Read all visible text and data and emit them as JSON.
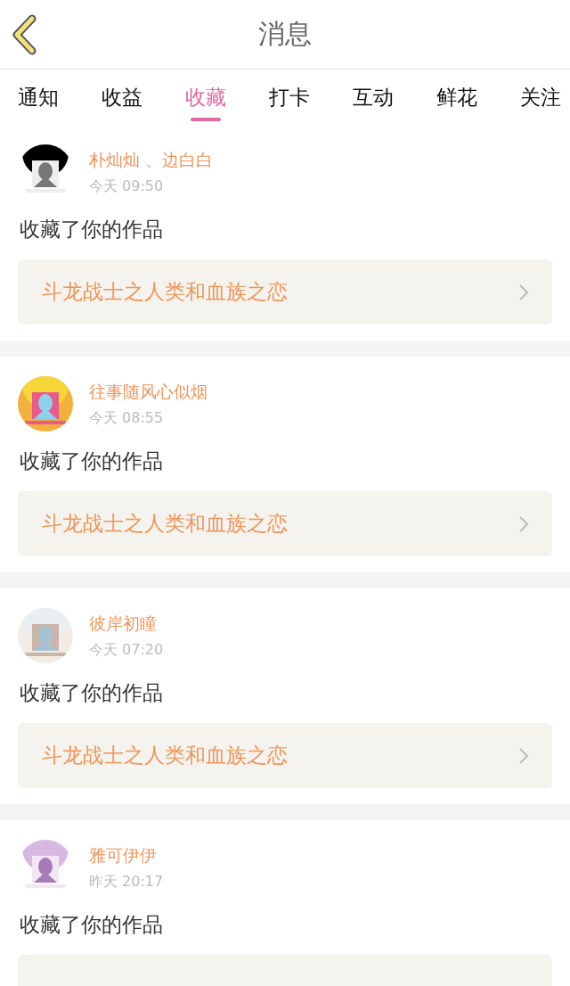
{
  "header": {
    "title": "消息"
  },
  "tabs": [
    {
      "label": "通知",
      "selected": false
    },
    {
      "label": "收益",
      "selected": false
    },
    {
      "label": "收藏",
      "selected": true
    },
    {
      "label": "打卡",
      "selected": false
    },
    {
      "label": "互动",
      "selected": false
    },
    {
      "label": "鲜花",
      "selected": false
    },
    {
      "label": "关注",
      "selected": false
    }
  ],
  "messages": [
    {
      "name": "朴灿灿 、边白白",
      "time": "今天 09:50",
      "action": "收藏了你的作品",
      "work_title": "斗龙战士之人类和血族之恋"
    },
    {
      "name": "往事随风心似烟",
      "time": "今天 08:55",
      "action": "收藏了你的作品",
      "work_title": "斗龙战士之人类和血族之恋"
    },
    {
      "name": "彼岸初瞳",
      "time": "今天 07:20",
      "action": "收藏了你的作品",
      "work_title": "斗龙战士之人类和血族之恋"
    },
    {
      "name": "雅可伊伊",
      "time": "昨天 20:17",
      "action": "收藏了你的作品"
    }
  ]
}
